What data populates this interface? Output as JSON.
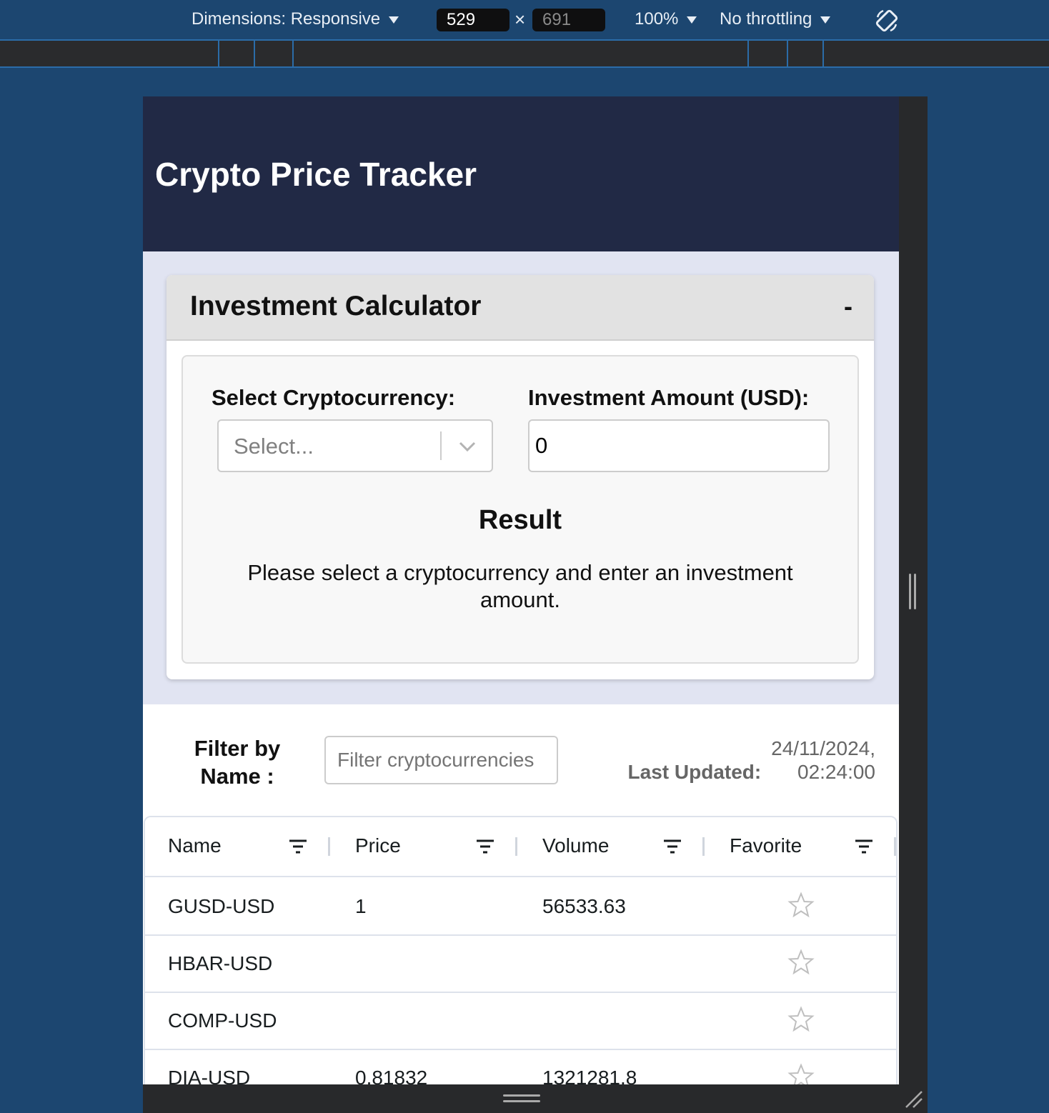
{
  "devtools": {
    "dimensions_label": "Dimensions: Responsive",
    "width": "529",
    "height": "691",
    "times": "×",
    "zoom": "100%",
    "throttling": "No throttling",
    "rotate_icon": "rotate-icon"
  },
  "app": {
    "title": "Crypto Price Tracker"
  },
  "calculator": {
    "title": "Investment Calculator",
    "collapse_label": "-",
    "crypto_label": "Select Cryptocurrency:",
    "crypto_placeholder": "Select...",
    "amount_label": "Investment Amount (USD):",
    "amount_value": "0",
    "result_title": "Result",
    "result_message": "Please select a cryptocurrency and enter an investment amount."
  },
  "filter": {
    "label": "Filter by Name :",
    "placeholder": "Filter cryptocurrencies",
    "value": "",
    "last_updated_label": "Last Updated:",
    "last_updated_value": "24/11/2024, 02:24:00"
  },
  "grid": {
    "columns": [
      "Name",
      "Price",
      "Volume",
      "Favorite"
    ],
    "rows": [
      {
        "name": "GUSD-USD",
        "price": "1",
        "volume": "56533.63",
        "favorite": false
      },
      {
        "name": "HBAR-USD",
        "price": "",
        "volume": "",
        "favorite": false
      },
      {
        "name": "COMP-USD",
        "price": "",
        "volume": "",
        "favorite": false
      },
      {
        "name": "DIA-USD",
        "price": "0.81832",
        "volume": "1321281.8",
        "favorite": false
      }
    ]
  }
}
